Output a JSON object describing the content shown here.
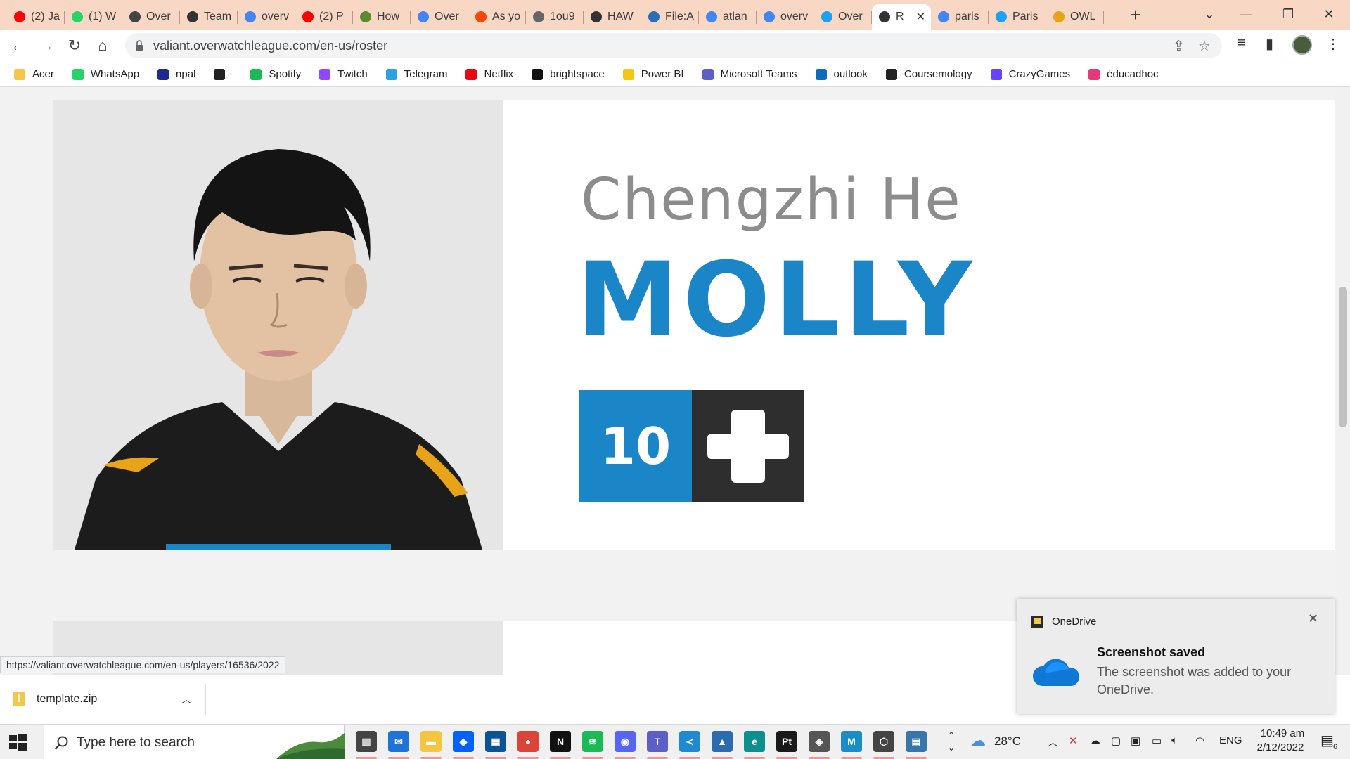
{
  "tabs": [
    {
      "title": "(2) Ja",
      "icon": "youtube-icon",
      "color": "#ff0000"
    },
    {
      "title": "(1) W",
      "icon": "whatsapp-icon",
      "color": "#25d366"
    },
    {
      "title": "Over",
      "icon": "overwatch-icon",
      "color": "#444444"
    },
    {
      "title": "Team",
      "icon": "team-icon",
      "color": "#333333"
    },
    {
      "title": "overv",
      "icon": "google-icon",
      "color": "#4285f4"
    },
    {
      "title": "(2) P",
      "icon": "youtube-icon",
      "color": "#ff0000"
    },
    {
      "title": "How",
      "icon": "wikihow-icon",
      "color": "#5b8a2f"
    },
    {
      "title": "Over",
      "icon": "google-icon",
      "color": "#4285f4"
    },
    {
      "title": "As yo",
      "icon": "reddit-icon",
      "color": "#ff4500"
    },
    {
      "title": "1ou9",
      "icon": "globe-icon",
      "color": "#666666"
    },
    {
      "title": "HAW",
      "icon": "team-icon",
      "color": "#333333"
    },
    {
      "title": "File:A",
      "icon": "wiki-icon",
      "color": "#2a6ebb"
    },
    {
      "title": "atlan",
      "icon": "google-icon",
      "color": "#4285f4"
    },
    {
      "title": "overv",
      "icon": "google-icon",
      "color": "#4285f4"
    },
    {
      "title": "Over",
      "icon": "twitter-icon",
      "color": "#1da1f2"
    },
    {
      "title": "R",
      "icon": "team-icon",
      "color": "#333333",
      "active": true
    },
    {
      "title": "paris",
      "icon": "google-icon",
      "color": "#4285f4"
    },
    {
      "title": "Paris",
      "icon": "twitter-icon",
      "color": "#1da1f2"
    },
    {
      "title": "OWL",
      "icon": "owl-icon",
      "color": "#e8a317"
    }
  ],
  "toolbar": {
    "url": "valiant.overwatchleague.com/en-us/roster"
  },
  "bookmarks": [
    {
      "label": "Acer",
      "icon": "folder-icon",
      "color": "#f6c648"
    },
    {
      "label": "WhatsApp",
      "icon": "whatsapp-icon",
      "color": "#25d366"
    },
    {
      "label": "npal",
      "icon": "npal-icon",
      "color": "#1d2b8f"
    },
    {
      "label": "",
      "icon": "globe-icon",
      "color": "#222222"
    },
    {
      "label": "Spotify",
      "icon": "spotify-icon",
      "color": "#1db954"
    },
    {
      "label": "Twitch",
      "icon": "twitch-icon",
      "color": "#9146ff"
    },
    {
      "label": "Telegram",
      "icon": "telegram-icon",
      "color": "#2aa3de"
    },
    {
      "label": "Netflix",
      "icon": "netflix-icon",
      "color": "#e50914"
    },
    {
      "label": "brightspace",
      "icon": "np-icon",
      "color": "#111111"
    },
    {
      "label": "Power BI",
      "icon": "powerbi-icon",
      "color": "#f2c811"
    },
    {
      "label": "Microsoft Teams",
      "icon": "teams-icon",
      "color": "#5b5fc7"
    },
    {
      "label": "outlook",
      "icon": "outlook-icon",
      "color": "#0f6cbd"
    },
    {
      "label": "Coursemology",
      "icon": "coursemology-icon",
      "color": "#222222"
    },
    {
      "label": "CrazyGames",
      "icon": "crazygames-icon",
      "color": "#6842ff"
    },
    {
      "label": "éducadhoc",
      "icon": "educadhoc-icon",
      "color": "#e5397a"
    }
  ],
  "player": {
    "real_name": "Chengzhi He",
    "handle": "MOLLY",
    "number": "10",
    "role_icon": "support-plus-icon"
  },
  "colors": {
    "accent": "#1a86c8",
    "dark": "#2e2e2e"
  },
  "status_link": "https://valiant.overwatchleague.com/en-us/players/16536/2022",
  "download": {
    "filename": "template.zip"
  },
  "toast": {
    "app": "OneDrive",
    "title": "Screenshot saved",
    "body": "The screenshot was added to your OneDrive."
  },
  "taskbar": {
    "search_placeholder": "Type here to search",
    "temperature": "28°C",
    "language": "ENG",
    "time": "10:49 am",
    "date": "2/12/2022",
    "notification_count": "6",
    "apps": [
      {
        "name": "task-view-icon",
        "color": "#444444",
        "glyph": "▥"
      },
      {
        "name": "mail-icon",
        "color": "#1e73d8",
        "glyph": "✉"
      },
      {
        "name": "file-explorer-icon",
        "color": "#f4c542",
        "glyph": "▬"
      },
      {
        "name": "dropbox-icon",
        "color": "#0061ff",
        "glyph": "◆"
      },
      {
        "name": "store-icon",
        "color": "#0b5394",
        "glyph": "▦"
      },
      {
        "name": "chrome-icon",
        "color": "#db4437",
        "glyph": "●"
      },
      {
        "name": "netflix-icon",
        "color": "#111111",
        "glyph": "N"
      },
      {
        "name": "spotify-icon",
        "color": "#1db954",
        "glyph": "≋"
      },
      {
        "name": "discord-icon",
        "color": "#5865f2",
        "glyph": "◉"
      },
      {
        "name": "teams-icon",
        "color": "#5b5fc7",
        "glyph": "T"
      },
      {
        "name": "vscode-icon",
        "color": "#1f8ad2",
        "glyph": "≺"
      },
      {
        "name": "photos-icon",
        "color": "#2b6cb0",
        "glyph": "▲"
      },
      {
        "name": "edge-icon",
        "color": "#0c8f8f",
        "glyph": "e"
      },
      {
        "name": "pycharm-icon",
        "color": "#1a1a1a",
        "glyph": "Pt"
      },
      {
        "name": "unity-icon",
        "color": "#555555",
        "glyph": "◈"
      },
      {
        "name": "m-app-icon",
        "color": "#1a8cc8",
        "glyph": "M"
      },
      {
        "name": "unity-hub-icon",
        "color": "#444444",
        "glyph": "⬡"
      },
      {
        "name": "python-icon",
        "color": "#3776ab",
        "glyph": "▤"
      }
    ]
  }
}
